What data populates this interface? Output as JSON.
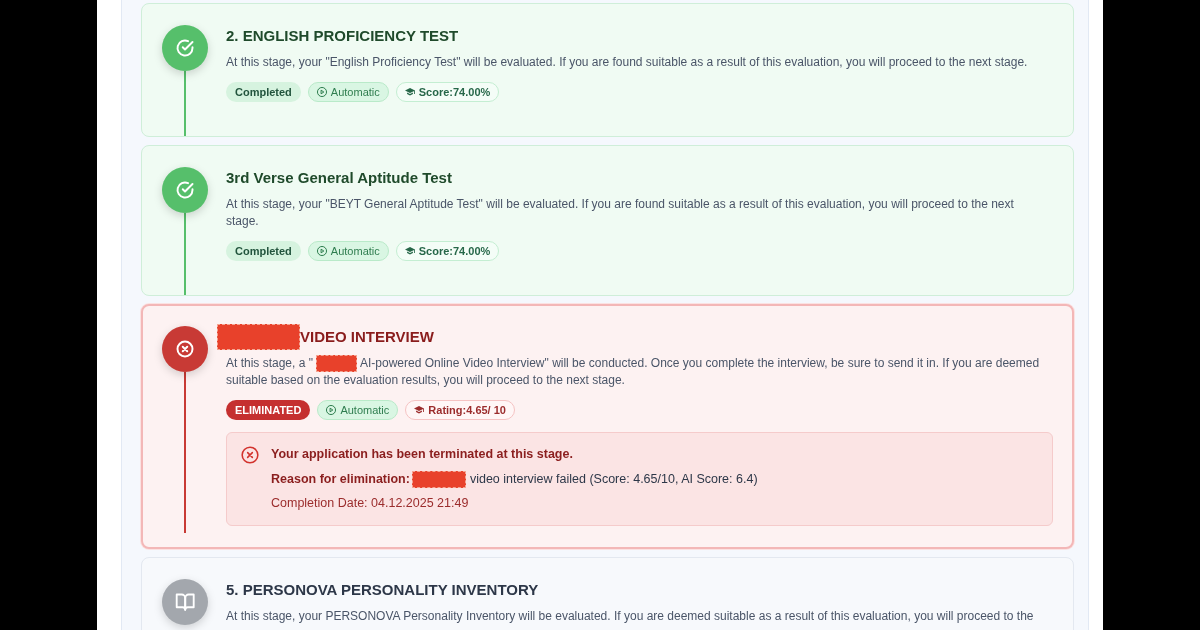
{
  "stages": [
    {
      "kind": "completed",
      "title": [
        {
          "kind": "text",
          "text": "2. ENGLISH PROFICIENCY TEST"
        }
      ],
      "description": [
        {
          "kind": "text",
          "text": "At this stage, your \"English Proficiency Test\" will be evaluated. If you are found suitable as a result of this evaluation, you will proceed to the next stage."
        }
      ],
      "badges": [
        {
          "kind": "status",
          "text": "Completed"
        },
        {
          "kind": "mode",
          "text": "Automatic"
        },
        {
          "kind": "score",
          "text": "Score:74.00%"
        }
      ]
    },
    {
      "kind": "completed",
      "title": [
        {
          "kind": "text",
          "text": "3rd Verse General Aptitude Test"
        }
      ],
      "description": [
        {
          "kind": "text",
          "text": "At this stage, your \"BEYT General Aptitude Test\" will be evaluated. If you are found suitable as a result of this evaluation, you will proceed to the next stage."
        }
      ],
      "badges": [
        {
          "kind": "status",
          "text": "Completed"
        },
        {
          "kind": "mode",
          "text": "Automatic"
        },
        {
          "kind": "score",
          "text": "Score:74.00%"
        }
      ]
    },
    {
      "kind": "eliminated",
      "title": [
        {
          "kind": "redacted"
        },
        {
          "kind": "text",
          "text": "VIDEO INTERVIEW"
        }
      ],
      "description": [
        {
          "kind": "text",
          "text": "At this stage, a \""
        },
        {
          "kind": "redacted"
        },
        {
          "kind": "text",
          "text": "AI-powered Online Video Interview\" will be conducted. Once you complete the interview, be sure to send it in. If you are deemed"
        },
        {
          "kind": "text",
          "text": "suitable based on the evaluation results, you will proceed to the next stage."
        }
      ],
      "badges": [
        {
          "kind": "status",
          "text": "ELIMINATED"
        },
        {
          "kind": "mode",
          "text": "Automatic"
        },
        {
          "kind": "score",
          "text": "Rating:4.65/ 10"
        }
      ],
      "notice": {
        "heading": "Your application has been terminated at this stage.",
        "reason_label": "Reason for elimination:",
        "reason": [
          {
            "kind": "redacted"
          },
          {
            "kind": "text",
            "text": "video interview failed (Score: 4.65/10, AI Score: 6.4)"
          }
        ],
        "completion": "Completion Date: 04.12.2025 21:49"
      }
    },
    {
      "kind": "pending",
      "title": [
        {
          "kind": "text",
          "text": "5. PERSONOVA PERSONALITY INVENTORY"
        }
      ],
      "description": [
        {
          "kind": "text",
          "text": "At this stage, your PERSONOVA Personality Inventory will be evaluated. If you are deemed suitable as a result of this evaluation, you will proceed to the"
        }
      ]
    }
  ]
}
